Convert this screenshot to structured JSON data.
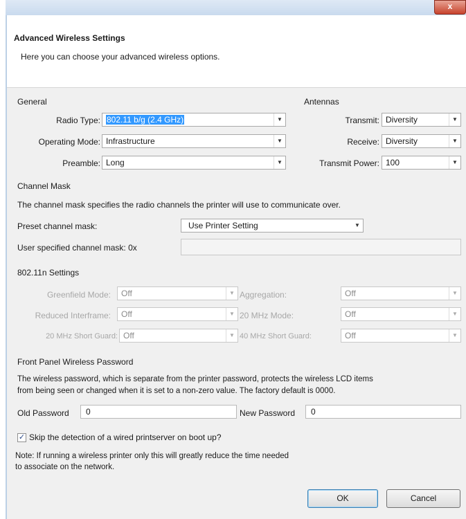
{
  "window": {
    "close_glyph": "x",
    "title": "Advanced Wireless Settings",
    "subtitle": "Here you can choose your advanced wireless options."
  },
  "general": {
    "heading": "General",
    "radio_type": {
      "label": "Radio Type:",
      "value": "802.11 b/g (2.4 GHz)"
    },
    "operating_mode": {
      "label": "Operating Mode:",
      "value": "Infrastructure"
    },
    "preamble": {
      "label": "Preamble:",
      "value": "Long"
    }
  },
  "antennas": {
    "heading": "Antennas",
    "transmit": {
      "label": "Transmit:",
      "value": "Diversity"
    },
    "receive": {
      "label": "Receive:",
      "value": "Diversity"
    },
    "transmit_power": {
      "label": "Transmit Power:",
      "value": "100"
    }
  },
  "channel_mask": {
    "heading": "Channel Mask",
    "description": "The channel mask specifies the radio channels the printer will use to communicate over.",
    "preset_label": "Preset channel mask:",
    "preset_value": "Use Printer Setting",
    "user_label": "User specified channel mask: 0x",
    "user_value": ""
  },
  "n_settings": {
    "heading": "802.11n Settings",
    "greenfield": {
      "label": "Greenfield Mode:",
      "value": "Off"
    },
    "aggregation": {
      "label": "Aggregation:",
      "value": "Off"
    },
    "reduced_interframe": {
      "label": "Reduced Interframe:",
      "value": "Off"
    },
    "mhz20_mode": {
      "label": "20 MHz Mode:",
      "value": "Off"
    },
    "mhz20_short_guard": {
      "label": "20 MHz Short Guard:",
      "value": "Off"
    },
    "mhz40_short_guard": {
      "label": "40 MHz Short Guard:",
      "value": "Off"
    }
  },
  "password": {
    "heading": "Front Panel Wireless Password",
    "description_line1": "The wireless password, which is separate from the printer password, protects the wireless LCD items",
    "description_line2": "from being seen or changed when it is set to a non-zero value. The factory default is 0000.",
    "old_label": "Old Password",
    "old_value": "0",
    "new_label": "New Password",
    "new_value": "0"
  },
  "skip_detection": {
    "checked_glyph": "✓",
    "label": "Skip the detection of a wired printserver on boot up?"
  },
  "note": {
    "line1": "Note: If running a wireless printer only this will greatly reduce the time needed",
    "line2": "to associate on the network."
  },
  "buttons": {
    "ok": "OK",
    "cancel": "Cancel"
  },
  "icons": {
    "dropdown": "▼"
  }
}
